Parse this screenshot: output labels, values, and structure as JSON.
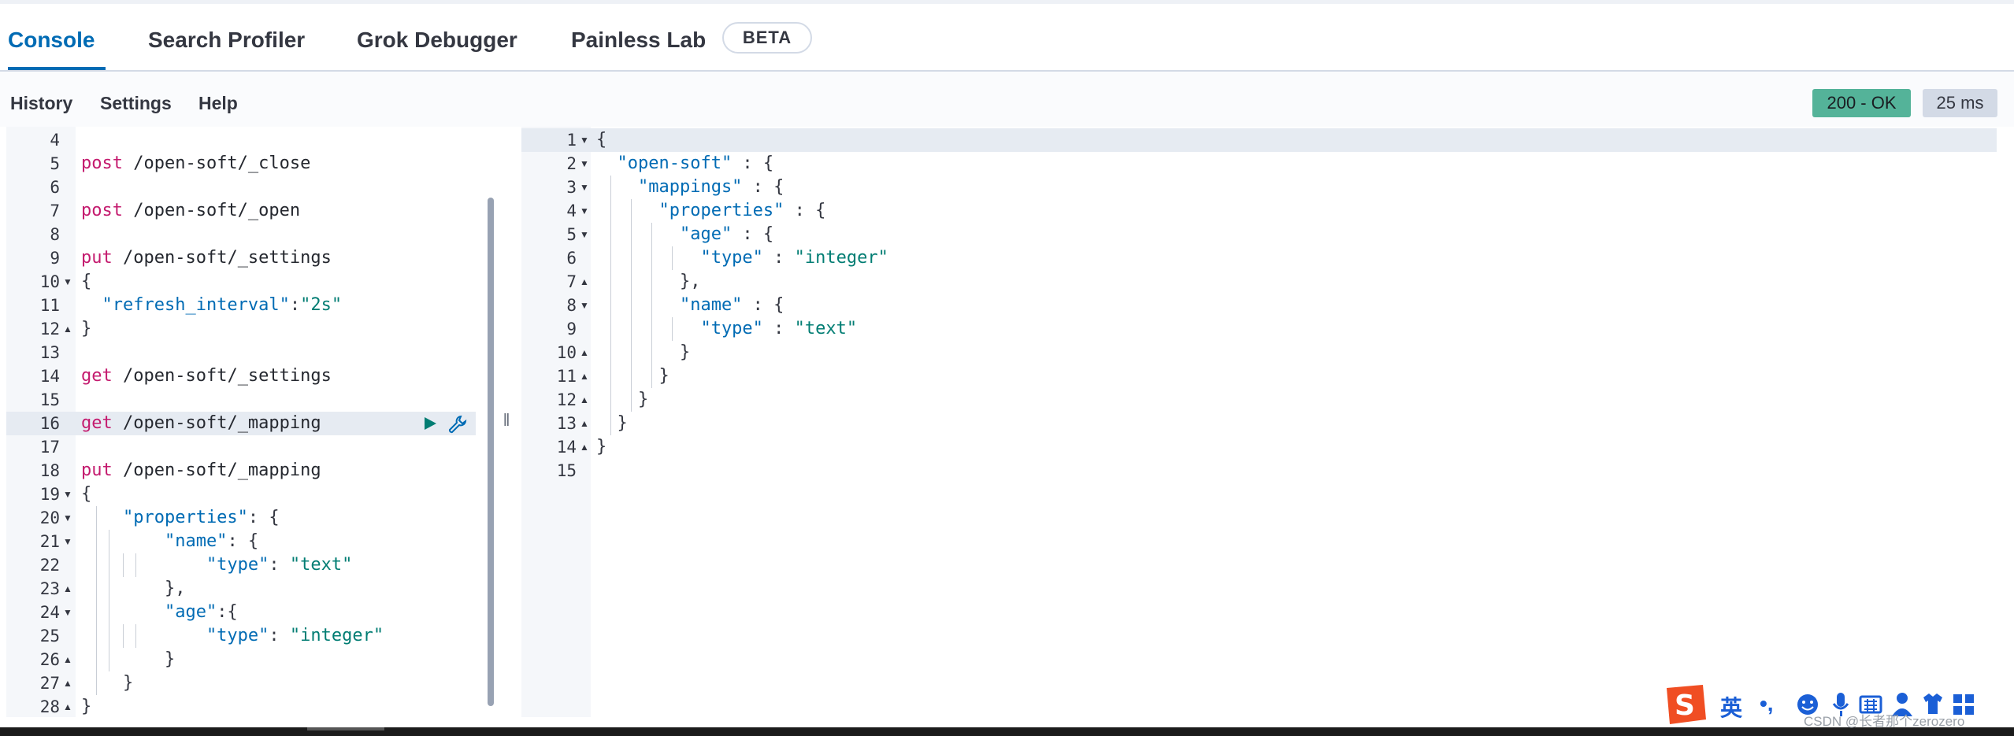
{
  "tabs": {
    "items": [
      {
        "label": "Console",
        "active": true
      },
      {
        "label": "Search Profiler",
        "active": false
      },
      {
        "label": "Grok Debugger",
        "active": false
      },
      {
        "label": "Painless Lab",
        "active": false
      }
    ],
    "beta_badge": "BETA"
  },
  "toolbar": {
    "history": "History",
    "settings": "Settings",
    "help": "Help",
    "status": "200 - OK",
    "time": "25 ms"
  },
  "editor": {
    "lines": [
      {
        "n": "4",
        "fold": ""
      },
      {
        "n": "5",
        "fold": "",
        "method": "post",
        "path": " /open-soft/_close"
      },
      {
        "n": "6",
        "fold": ""
      },
      {
        "n": "7",
        "fold": "",
        "method": "post",
        "path": " /open-soft/_open"
      },
      {
        "n": "8",
        "fold": ""
      },
      {
        "n": "9",
        "fold": "",
        "method": "put",
        "path": " /open-soft/_settings"
      },
      {
        "n": "10",
        "fold": "▼",
        "text": "{"
      },
      {
        "n": "11",
        "fold": "",
        "key": "  \"refresh_interval\"",
        "sep": ":",
        "str": "\"2s\""
      },
      {
        "n": "12",
        "fold": "▲",
        "text": "}"
      },
      {
        "n": "13",
        "fold": ""
      },
      {
        "n": "14",
        "fold": "",
        "method": "get",
        "path": " /open-soft/_settings"
      },
      {
        "n": "15",
        "fold": ""
      },
      {
        "n": "16",
        "fold": "",
        "method": "get",
        "path": " /open-soft/_mapping",
        "active": true
      },
      {
        "n": "17",
        "fold": ""
      },
      {
        "n": "18",
        "fold": "",
        "method": "put",
        "path": " /open-soft/_mapping"
      },
      {
        "n": "19",
        "fold": "▼",
        "text": "{"
      },
      {
        "n": "20",
        "fold": "▼",
        "key": "    \"properties\"",
        "sep": ": {"
      },
      {
        "n": "21",
        "fold": "▼",
        "key": "        \"name\"",
        "sep": ": {"
      },
      {
        "n": "22",
        "fold": "",
        "key": "            \"type\"",
        "sep": ": ",
        "str": "\"text\""
      },
      {
        "n": "23",
        "fold": "▲",
        "text": "        },"
      },
      {
        "n": "24",
        "fold": "▼",
        "key": "        \"age\"",
        "sep": ":{"
      },
      {
        "n": "25",
        "fold": "",
        "key": "            \"type\"",
        "sep": ": ",
        "str": "\"integer\""
      },
      {
        "n": "26",
        "fold": "▲",
        "text": "        }"
      },
      {
        "n": "27",
        "fold": "▲",
        "text": "    }"
      },
      {
        "n": "28",
        "fold": "▲",
        "text": "}"
      }
    ]
  },
  "output": {
    "lines": [
      {
        "n": "1",
        "fold": "▼",
        "text": "{",
        "active": true
      },
      {
        "n": "2",
        "fold": "▼",
        "key": "  \"open-soft\"",
        "sep": " : {"
      },
      {
        "n": "3",
        "fold": "▼",
        "key": "    \"mappings\"",
        "sep": " : {"
      },
      {
        "n": "4",
        "fold": "▼",
        "key": "      \"properties\"",
        "sep": " : {"
      },
      {
        "n": "5",
        "fold": "▼",
        "key": "        \"age\"",
        "sep": " : {"
      },
      {
        "n": "6",
        "fold": "",
        "key": "          \"type\"",
        "sep": " : ",
        "str": "\"integer\""
      },
      {
        "n": "7",
        "fold": "▲",
        "text": "        },"
      },
      {
        "n": "8",
        "fold": "▼",
        "key": "        \"name\"",
        "sep": " : {"
      },
      {
        "n": "9",
        "fold": "",
        "key": "          \"type\"",
        "sep": " : ",
        "str": "\"text\""
      },
      {
        "n": "10",
        "fold": "▲",
        "text": "        }"
      },
      {
        "n": "11",
        "fold": "▲",
        "text": "      }"
      },
      {
        "n": "12",
        "fold": "▲",
        "text": "    }"
      },
      {
        "n": "13",
        "fold": "▲",
        "text": "  }"
      },
      {
        "n": "14",
        "fold": "▲",
        "text": "}"
      },
      {
        "n": "15",
        "fold": ""
      }
    ]
  },
  "ime_toolbar": {
    "lang": "英",
    "punct": "•,",
    "watermark": "CSDN @长者那个zerozero"
  },
  "colors": {
    "accent": "#006bb4",
    "status_ok": "#54b399",
    "method": "#c41a6e",
    "string": "#017d73"
  }
}
